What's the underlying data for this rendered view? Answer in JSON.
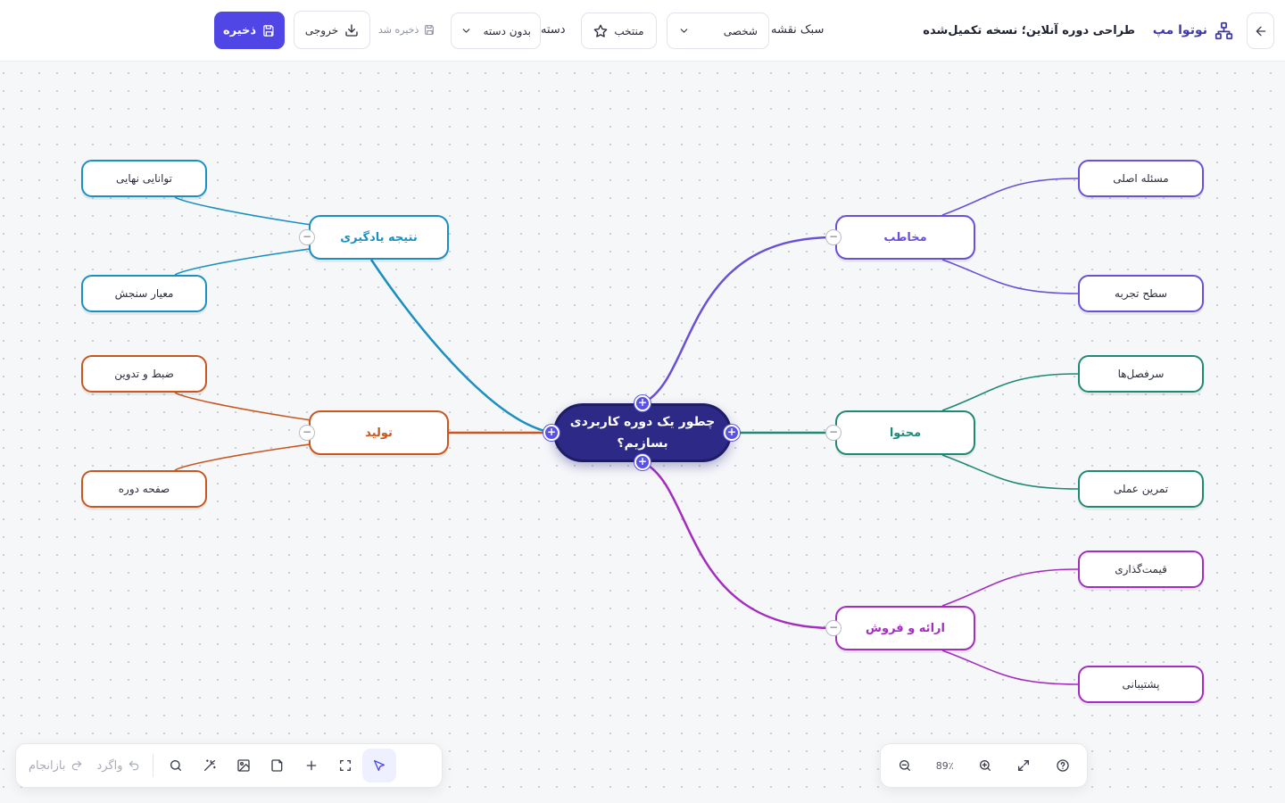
{
  "header": {
    "brand": "نوتوا مپ",
    "doc_title": "طراحی دوره آنلاین؛ نسخه تکمیل‌شده",
    "style_label": "سبک نقشه",
    "style_value": "شخصی",
    "favorite_label": "منتخب",
    "category_label": "دسته",
    "category_value": "بدون دسته",
    "saved_status": "ذخیره شد",
    "export_label": "خروجی",
    "save_label": "ذخیره"
  },
  "mindmap": {
    "center": "چطور یک دوره کاربردی بسازیم؟",
    "branches": [
      {
        "id": "audience",
        "label": "مخاطب",
        "color": "#6a4fd8",
        "side": "right",
        "children": [
          "مسئله اصلی",
          "سطح تجربه"
        ]
      },
      {
        "id": "content",
        "label": "محتوا",
        "color": "#1f8a74",
        "side": "right",
        "children": [
          "سرفصل‌ها",
          "تمرین عملی"
        ]
      },
      {
        "id": "sales",
        "label": "ارائه و فروش",
        "color": "#a42cc0",
        "side": "right",
        "children": [
          "قیمت‌گذاری",
          "پشتیبانی"
        ]
      },
      {
        "id": "outcome",
        "label": "نتیجه یادگیری",
        "color": "#1a8fc2",
        "side": "left",
        "children": [
          "توانایی نهایی",
          "معیار سنجش"
        ]
      },
      {
        "id": "production",
        "label": "تولید",
        "color": "#c8571f",
        "side": "left",
        "children": [
          "ضبط و تدوین",
          "صفحه دوره"
        ]
      }
    ]
  },
  "bottom_toolbar": {
    "redo_label": "بازانجام",
    "undo_label": "واگرد",
    "tools": [
      "search-icon",
      "magic-wand-icon",
      "image-icon",
      "note-icon",
      "plus-icon",
      "fit-icon",
      "pointer-icon"
    ]
  },
  "zoom": {
    "level": "89٪"
  },
  "colors": {
    "accent": "#4f46e5",
    "center_node": "#2d2a87"
  }
}
